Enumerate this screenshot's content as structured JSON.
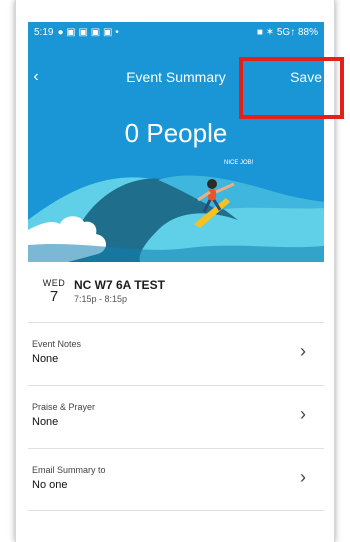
{
  "status_bar": {
    "time": "5:19",
    "left_icons": "● ▣ ▣ ▣ ▣ •",
    "right_text": "■ ✶ 5G↑ 88%"
  },
  "header": {
    "title": "Event Summary",
    "save_label": "Save",
    "back_icon": "‹"
  },
  "hero": {
    "count_text": "0 People",
    "badge_text": "NICE JOB!"
  },
  "event": {
    "weekday": "WED",
    "day": "7",
    "name": "NC W7 6A TEST",
    "time": "7:15p - 8:15p"
  },
  "rows": [
    {
      "label": "Event Notes",
      "value": "None"
    },
    {
      "label": "Praise & Prayer",
      "value": "None"
    },
    {
      "label": "Email Summary to",
      "value": "No one"
    }
  ],
  "colors": {
    "hero_blue": "#1a96d6",
    "wave_dark": "#1f6f8c",
    "wave_light": "#5fd0e8",
    "highlight_red": "#e3201a"
  },
  "icons": {
    "chevron": "›"
  }
}
